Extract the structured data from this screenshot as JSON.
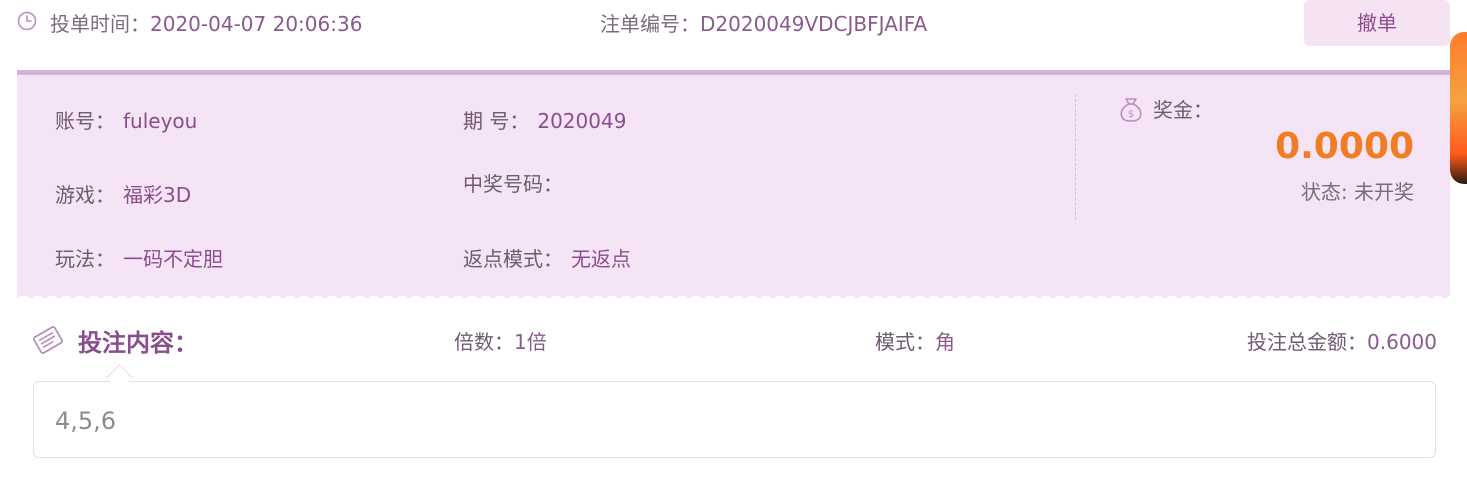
{
  "header": {
    "bet_time_label": "投单时间：",
    "bet_time_value": "2020-04-07 20:06:36",
    "order_no_label": "注单编号：",
    "order_no_value": "D2020049VDCJBFJAIFA",
    "cancel_label": "撤单"
  },
  "info": {
    "account_label": "账号：",
    "account_value": "fuleyou",
    "game_label": "游戏：",
    "game_value": "福彩3D",
    "play_label": "玩法：",
    "play_value": "一码不定胆",
    "period_label": "期 号：",
    "period_value": "2020049",
    "winning_label": "中奖号码：",
    "winning_value": "",
    "rebate_label": "返点模式：",
    "rebate_value": "无返点",
    "prize_label": "奖金：",
    "prize_amount": "0.0000",
    "status_text": "状态: 未开奖"
  },
  "bet": {
    "title": "投注内容：",
    "multiple_label": "倍数：",
    "multiple_value": "1倍",
    "mode_label": "模式：",
    "mode_value": "角",
    "total_label": "投注总金额：",
    "total_value": "0.6000",
    "content": "4,5,6"
  },
  "icons": {
    "clock": "clock-icon",
    "money": "money-bag-icon",
    "bet": "bet-slip-icon"
  },
  "colors": {
    "accent": "#8a4e8e",
    "panel_bg": "#f5e4f5",
    "prize": "#f07c24"
  }
}
